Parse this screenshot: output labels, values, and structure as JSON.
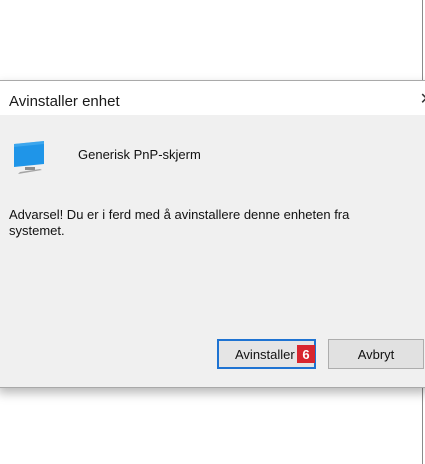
{
  "dialog": {
    "title": "Avinstaller enhet",
    "close_icon": "close-icon",
    "device_icon": "monitor-icon",
    "device_name": "Generisk PnP-skjerm",
    "warning": "Advarsel! Du er i ferd med å avinstallere denne enheten fra systemet.",
    "buttons": {
      "uninstall": "Avinstaller",
      "cancel": "Avbryt"
    },
    "step_badge": "6",
    "colors": {
      "badge": "#d8262f",
      "focus_border": "#1e73d2",
      "monitor": "#1f95e8"
    }
  }
}
